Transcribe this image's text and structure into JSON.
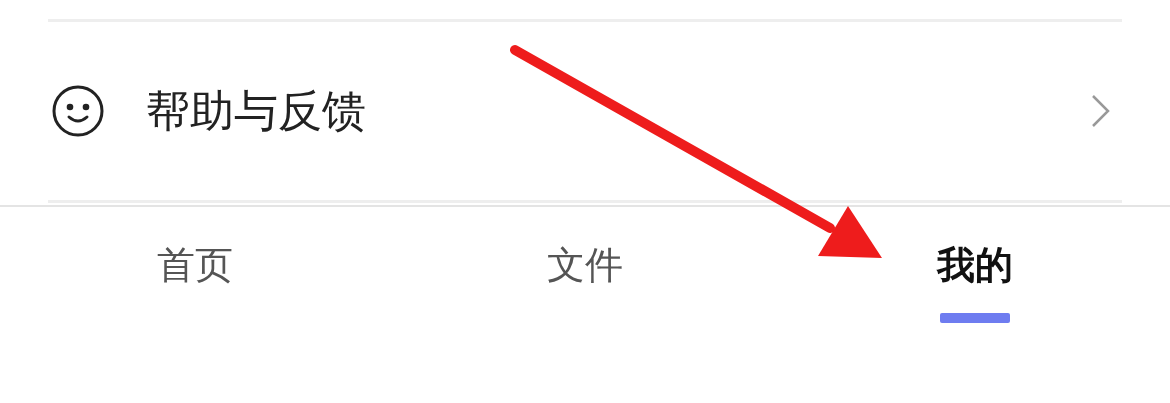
{
  "menu_items": [
    {
      "label": "帮助与反馈"
    }
  ],
  "tabs": [
    {
      "label": "首页",
      "selected": false
    },
    {
      "label": "文件",
      "selected": false
    },
    {
      "label": "我的",
      "selected": true
    }
  ]
}
